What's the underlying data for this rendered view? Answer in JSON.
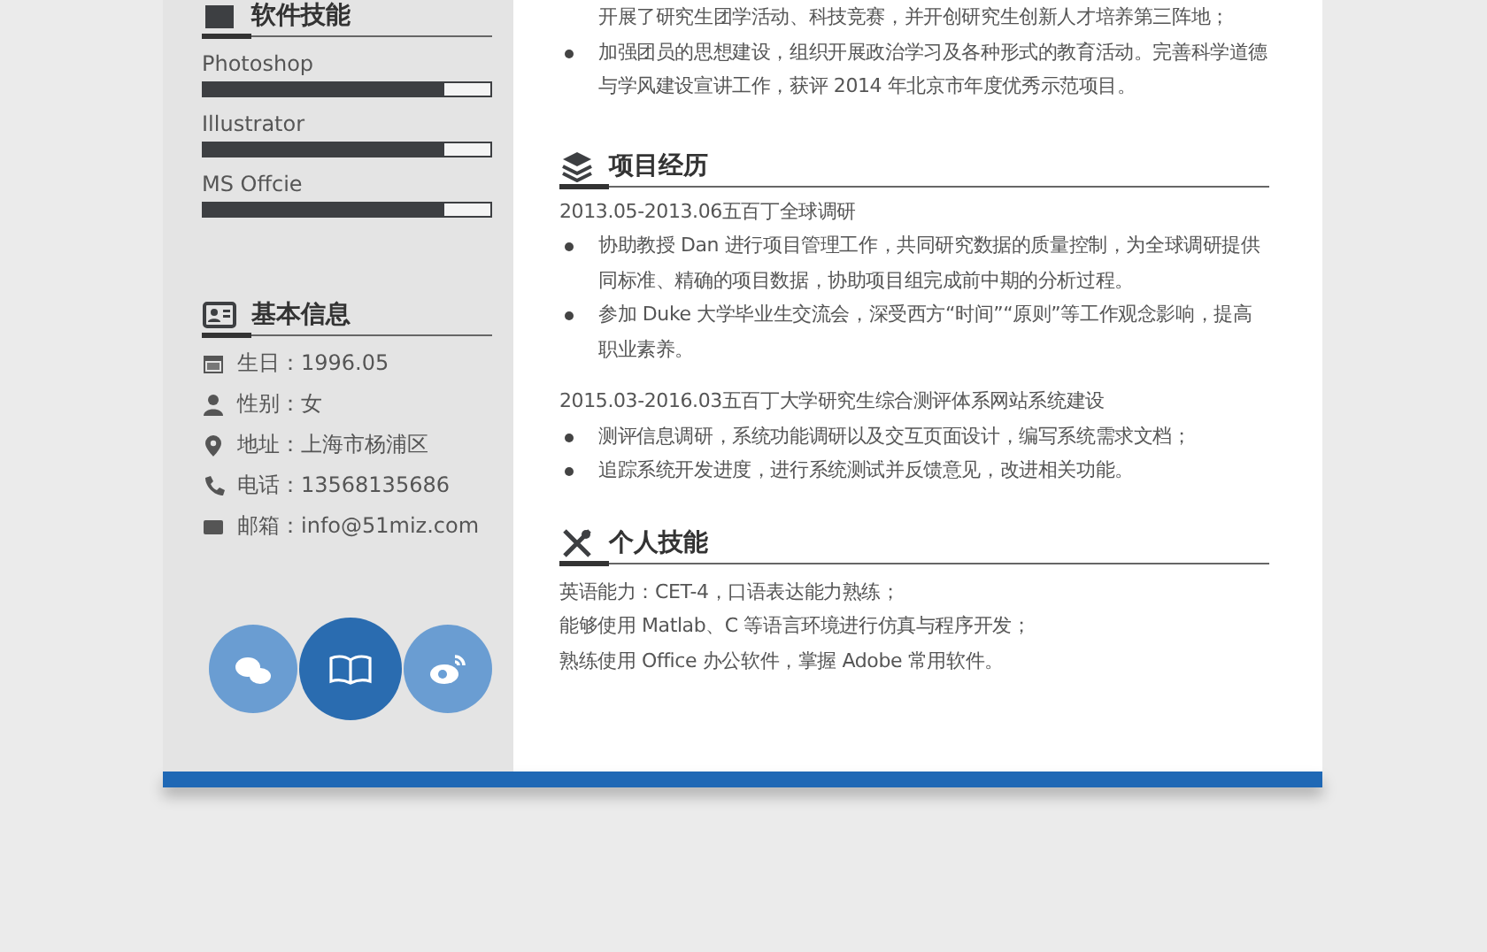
{
  "sidebar": {
    "skills_heading": "软件技能",
    "skills": [
      {
        "name": "Photoshop",
        "level": 0.84
      },
      {
        "name": "Illustrator",
        "level": 0.84
      },
      {
        "name": "MS Offcie",
        "level": 0.84
      }
    ],
    "info_heading": "基本信息",
    "info": [
      {
        "kind": "birthday",
        "text": "生日：1996.05"
      },
      {
        "kind": "gender",
        "text": "性别：女"
      },
      {
        "kind": "address",
        "text": "地址：上海市杨浦区"
      },
      {
        "kind": "phone",
        "text": "电话：13568135686"
      },
      {
        "kind": "email",
        "text": "邮箱：info@51miz.com"
      }
    ],
    "social": [
      {
        "kind": "chat",
        "selected": false
      },
      {
        "kind": "book",
        "selected": true
      },
      {
        "kind": "weibo",
        "selected": false
      }
    ]
  },
  "main": {
    "top_items": [
      {
        "kind": "continuation",
        "text": "开展了研究生团学活动、科技竞赛，并开创研究生创新人才培养第三阵地；"
      },
      {
        "kind": "bullet",
        "text": "加强团员的思想建设，组织开展政治学习及各种形式的教育活动。完善科学道德与学风建设宣讲工作，获评 2014 年北京市年度优秀示范项目。"
      }
    ],
    "projects_heading": "项目经历",
    "projects": [
      {
        "title": "2013.05-2013.06五百丁全球调研",
        "bullets": [
          "协助教授 Dan 进行项目管理工作，共同研究数据的质量控制，为全球调研提供同标准、精确的项目数据，协助项目组完成前中期的分析过程。",
          "参加 Duke 大学毕业生交流会，深受西方“时间”“原则”等工作观念影响，提高职业素养。"
        ]
      },
      {
        "title": "2015.03-2016.03五百丁大学研究生综合测评体系网站系统建设",
        "bullets": [
          "测评信息调研，系统功能调研以及交互页面设计，编写系统需求文档；",
          "追踪系统开发进度，进行系统测试并反馈意见，改进相关功能。"
        ]
      }
    ],
    "skills_heading": "个人技能",
    "skills": [
      "英语能力：CET-4，口语表达能力熟练；",
      "能够使用 Matlab、C 等语言环境进行仿真与程序开发；",
      "熟练使用 Office 办公软件，掌握 Adobe 常用软件。"
    ]
  }
}
